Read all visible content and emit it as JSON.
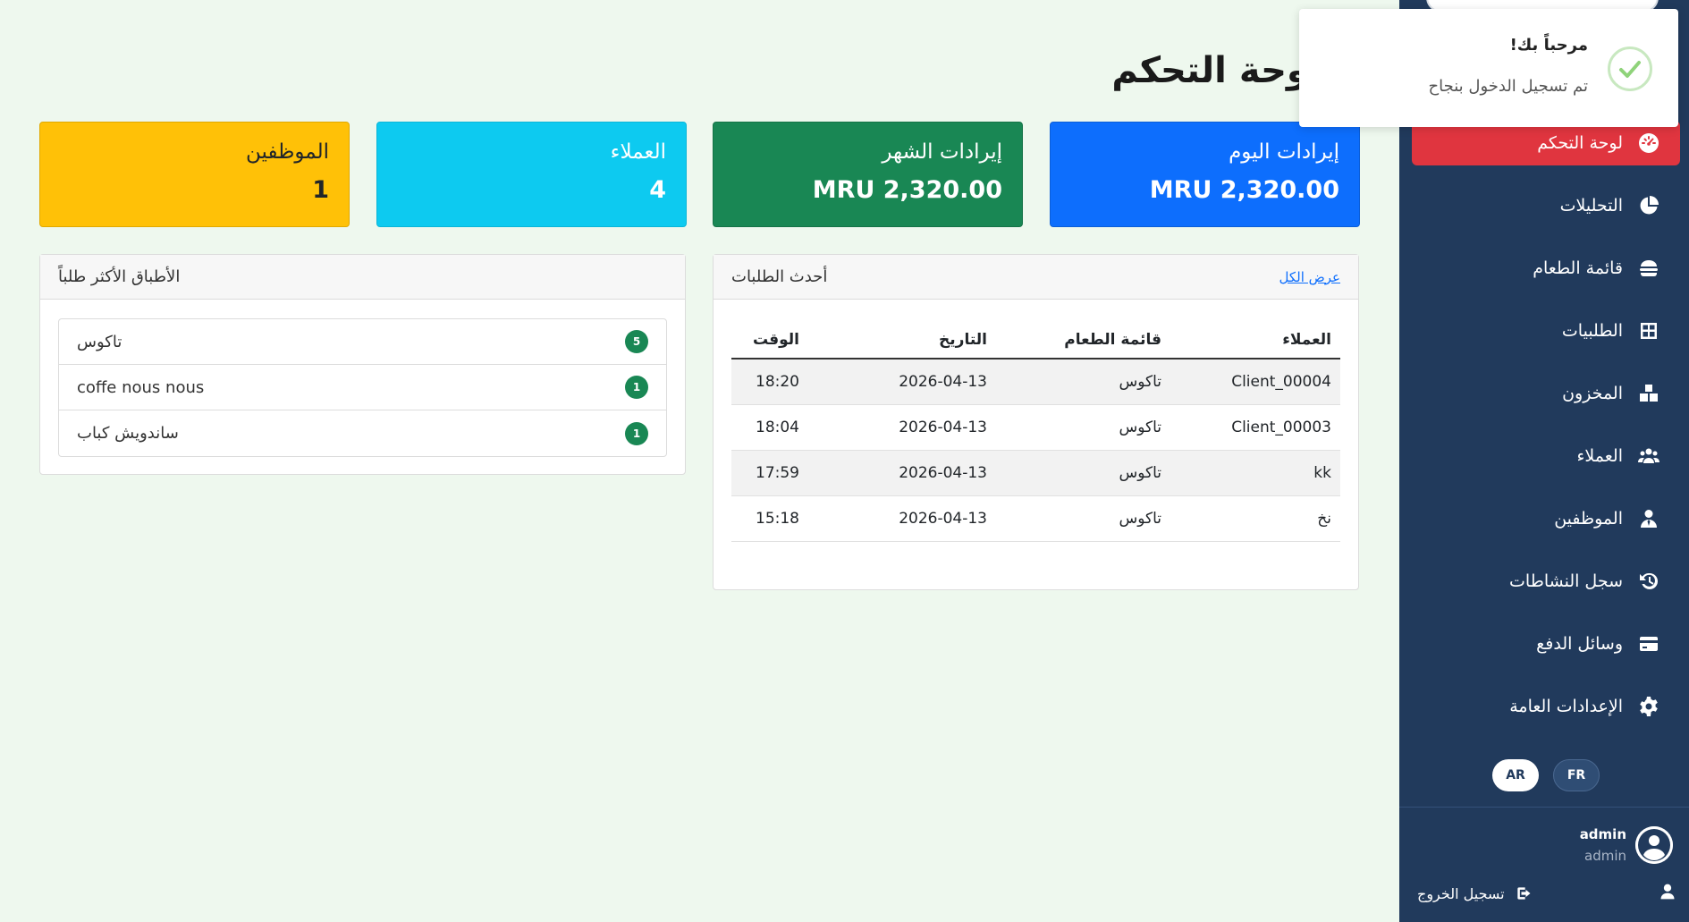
{
  "page": {
    "title": "لوحة التحكم"
  },
  "toast": {
    "title": "مرحباً بك!",
    "message": "تم تسجيل الدخول بنجاح",
    "icon": "check-circle-icon"
  },
  "stats": [
    {
      "label": "إيرادات اليوم",
      "value": "MRU 2,320.00",
      "color": "#0d6efd"
    },
    {
      "label": "إيرادات الشهر",
      "value": "MRU 2,320.00",
      "color": "#198754"
    },
    {
      "label": "العملاء",
      "value": "4",
      "color": "#0dcaf0"
    },
    {
      "label": "الموظفين",
      "value": "1",
      "color": "#ffc107"
    }
  ],
  "orders": {
    "title": "أحدث الطلبات",
    "view_all": "عرض الكل",
    "columns": [
      "العملاء",
      "قائمة الطعام",
      "التاريخ",
      "الوقت"
    ],
    "rows": [
      [
        "Client_00004",
        "تاكوس",
        "2026-04-13",
        "18:20"
      ],
      [
        "Client_00003",
        "تاكوس",
        "2026-04-13",
        "18:04"
      ],
      [
        "kk",
        "تاكوس",
        "2026-04-13",
        "17:59"
      ],
      [
        "نخ",
        "تاكوس",
        "2026-04-13",
        "15:18"
      ]
    ]
  },
  "top_dishes": {
    "title": "الأطباق الأكثر طلباً",
    "items": [
      {
        "name": "تاكوس",
        "count": "5"
      },
      {
        "name": "coffe nous nous",
        "count": "1"
      },
      {
        "name": "ساندويش كباب",
        "count": "1"
      }
    ]
  },
  "sidebar": {
    "items": [
      {
        "label": "لوحة التحكم",
        "icon": "dashboard-gauge-icon",
        "active": true
      },
      {
        "label": "التحليلات",
        "icon": "pie-chart-icon"
      },
      {
        "label": "قائمة الطعام",
        "icon": "burger-icon"
      },
      {
        "label": "الطلبيات",
        "icon": "table-grid-icon"
      },
      {
        "label": "المخزون",
        "icon": "boxes-icon"
      },
      {
        "label": "العملاء",
        "icon": "users-icon"
      },
      {
        "label": "الموظفين",
        "icon": "user-tie-icon"
      },
      {
        "label": "سجل النشاطات",
        "icon": "history-icon"
      },
      {
        "label": "وسائل الدفع",
        "icon": "credit-card-icon"
      },
      {
        "label": "الإعدادات العامة",
        "icon": "gear-icon"
      }
    ],
    "languages": [
      "AR",
      "FR"
    ],
    "user": {
      "name": "admin",
      "role": "admin"
    },
    "logout_label": "تسجيل الخروج"
  },
  "colors": {
    "sidebar_bg": "#213a5c",
    "active_item": "#e0353f",
    "page_bg": "#eef8ee"
  }
}
